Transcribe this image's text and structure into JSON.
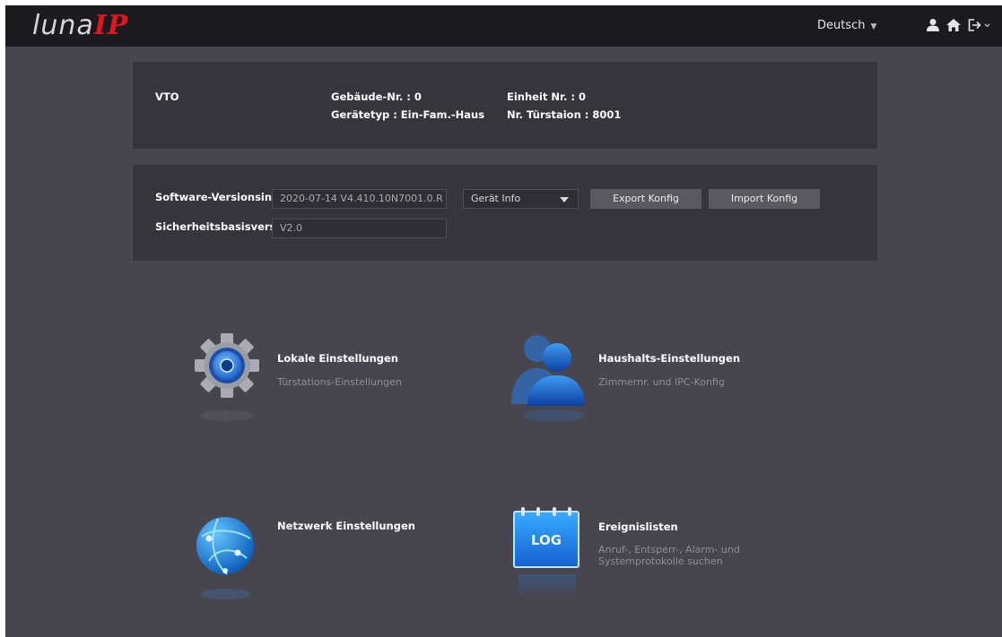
{
  "brand": {
    "part1": "luna",
    "part2": "IP"
  },
  "topbar": {
    "language": "Deutsch"
  },
  "device": {
    "type": "VTO",
    "building": "Gebäude-Nr. : 0",
    "unit": "Einheit Nr. : 0",
    "model": "Gerätetyp : Ein-Fam.-Haus",
    "door_station": "Nr. Türstaion : 8001"
  },
  "version": {
    "software_label": "Software-Versionsinfo",
    "software_value": "2020-07-14 V4.410.10N7001.0.R",
    "security_label": "Sicherheitsbasisversion",
    "security_value": "V2.0",
    "select_value": "Gerät Info",
    "export_label": "Export Konfig",
    "import_label": "Import Konfig"
  },
  "tiles": [
    {
      "title": "Lokale Einstellungen",
      "subtitle": "Türstations-Einstellungen",
      "icon": "gear-icon"
    },
    {
      "title": "Haushalts-Einstellungen",
      "subtitle": "Zimmernr. und IPC-Konfig",
      "icon": "users-icon"
    },
    {
      "title": "Netzwerk Einstellungen",
      "subtitle": "",
      "icon": "globe-icon"
    },
    {
      "title": "Ereignislisten",
      "subtitle": "Anruf-, Entsperr-, Alarm- und",
      "subtitle2": "Systemprotokolle suchen",
      "icon": "log-icon",
      "icon_text": "LOG"
    }
  ],
  "colors": {
    "accent": "#e3141b",
    "background": "#47464f",
    "panel": "#36353c",
    "topbar": "#1b1b1f"
  }
}
